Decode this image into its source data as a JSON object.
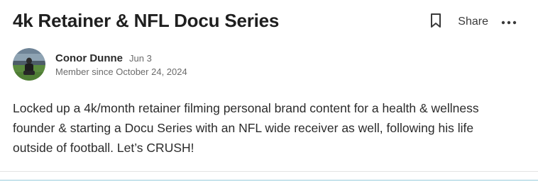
{
  "post": {
    "title": "4k Retainer & NFL Docu Series",
    "body": "Locked up a 4k/month retainer filming personal brand content for a health & wellness founder & starting a Docu Series with an NFL wide receiver as well, following his life outside of football. Let’s CRUSH!"
  },
  "actions": {
    "bookmark_icon": "bookmark-icon",
    "share_label": "Share",
    "more_icon": "more-horizontal-icon"
  },
  "author": {
    "name": "Conor Dunne",
    "date": "Jun 3",
    "member_since": "Member since October 24, 2024",
    "avatar_icon": "avatar-photo"
  },
  "colors": {
    "title": "#1f1f1f",
    "muted": "#6b6b6b",
    "divider": "#e4e4e4"
  }
}
